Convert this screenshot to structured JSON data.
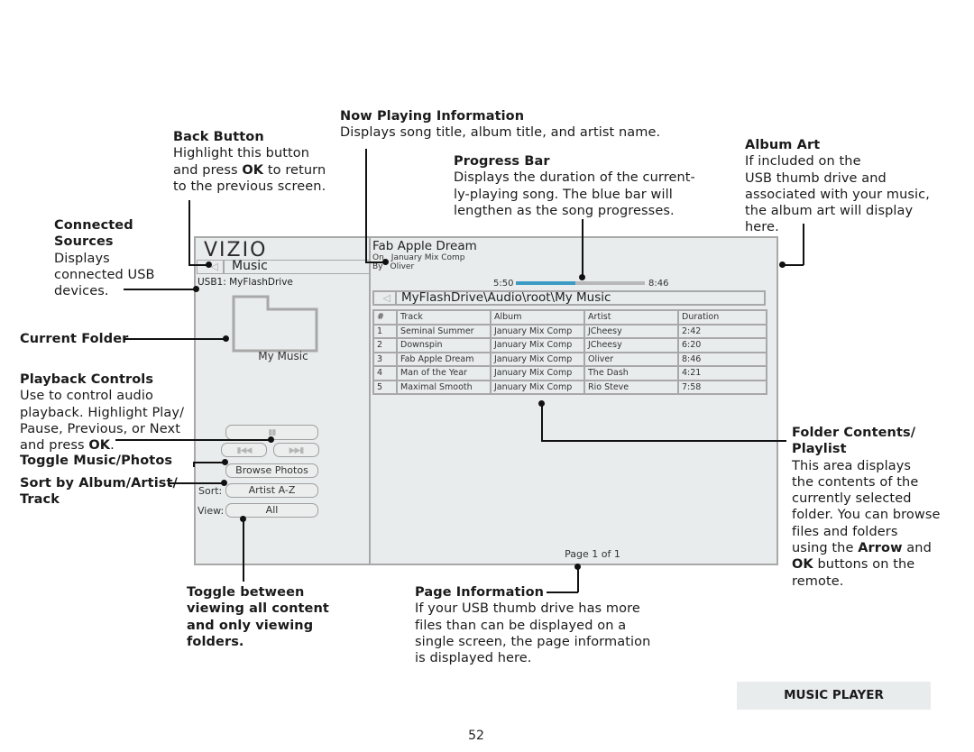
{
  "callouts": {
    "now_playing": {
      "title": "Now Playing Information",
      "lines": [
        "Displays song title, album title, and artist name."
      ]
    },
    "back_button": {
      "title": "Back Button",
      "lines": [
        "Highlight this button",
        "and press ",
        "OK",
        " to return",
        "to the previous screen."
      ]
    },
    "progress_bar": {
      "title": "Progress Bar",
      "lines": [
        "Displays the duration of the current-",
        "ly-playing song. The blue bar will",
        "lengthen as the song progresses."
      ]
    },
    "album_art": {
      "title": "Album Art",
      "lines": [
        "If included on the",
        "USB thumb drive and",
        "associated with your music,",
        "the album art will display",
        "here."
      ]
    },
    "connected_sources": {
      "title_1": "Connected",
      "title_2": "Sources",
      "lines": [
        "Displays",
        "connected USB",
        "devices."
      ]
    },
    "current_folder": {
      "title": "Current Folder"
    },
    "playback_controls": {
      "title": "Playback Controls",
      "lines": [
        "Use to control audio",
        "playback. Highlight Play/",
        "Pause, Previous, or Next",
        "and press ",
        "OK",
        "."
      ]
    },
    "toggle_music_photos": {
      "title": "Toggle Music/Photos"
    },
    "sort_by": {
      "title_1": "Sort by Album/Artist/",
      "title_2": "Track"
    },
    "folder_contents": {
      "title_1": "Folder Contents/",
      "title_2": "Playlist",
      "lines": [
        "This area displays",
        "the contents of the",
        "currently selected",
        "folder. You can browse",
        "files and folders",
        "using the ",
        "Arrow",
        " and",
        "OK",
        " buttons on the",
        "remote."
      ]
    },
    "toggle_view": {
      "lines": [
        "Toggle between",
        "viewing all content",
        "and only viewing",
        "folders."
      ]
    },
    "page_information": {
      "title": "Page Information",
      "lines": [
        "If your USB thumb drive has more",
        "files than can be displayed on a",
        "single screen, the page information",
        "is displayed here."
      ]
    }
  },
  "screen": {
    "logo": "VIZIO",
    "back_label": "Music",
    "back_icon": "triangle-left-icon",
    "usb_source": "USB1: MyFlashDrive",
    "folder_name": "My Music",
    "controls": {
      "play_pause_icon": "▮▮",
      "previous_icon": "▮◀◀",
      "next_icon": "▶▶▮",
      "browse_photos": "Browse Photos",
      "sort_label": "Sort:",
      "sort_value": "Artist A-Z",
      "view_label": "View:",
      "view_value": "All"
    },
    "now_playing": {
      "title": "Fab Apple Dream",
      "on_label": "On",
      "album": "January Mix Comp",
      "by_label": "By",
      "artist": "Oliver"
    },
    "progress": {
      "elapsed": "5:50",
      "total": "8:46",
      "fill_fraction": 0.46,
      "fill_color": "#3b9bc5"
    },
    "path": "MyFlashDrive\\Audio\\root\\My Music",
    "table": {
      "headers": [
        "#",
        "Track",
        "Album",
        "Artist",
        "Duration"
      ],
      "rows": [
        [
          "1",
          "Seminal Summer",
          "January Mix Comp",
          "JCheesy",
          "2:42"
        ],
        [
          "2",
          "Downspin",
          "January Mix Comp",
          "JCheesy",
          "6:20"
        ],
        [
          "3",
          "Fab Apple Dream",
          "January Mix Comp",
          "Oliver",
          "8:46"
        ],
        [
          "4",
          "Man of the Year",
          "January Mix Comp",
          "The Dash",
          "4:21"
        ],
        [
          "5",
          "Maximal Smooth",
          "January Mix Comp",
          "Rio Steve",
          "7:58"
        ]
      ]
    },
    "page_info": "Page 1 of 1"
  },
  "footer": {
    "section": "MUSIC PLAYER",
    "page_number": "52"
  }
}
